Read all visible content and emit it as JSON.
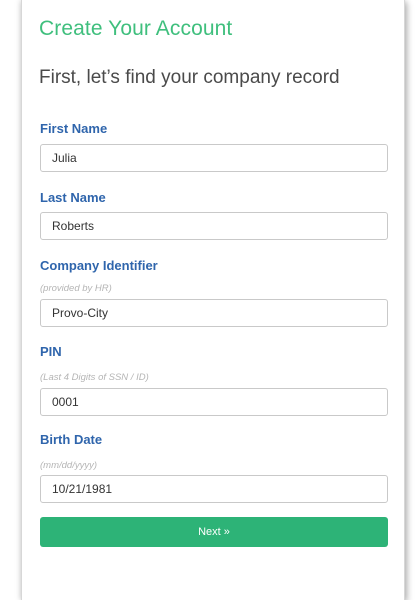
{
  "form": {
    "title": "Create Your Account",
    "subtitle": "First, let’s find your company record",
    "fields": {
      "first_name": {
        "label": "First Name",
        "value": "Julia"
      },
      "last_name": {
        "label": "Last Name",
        "value": "Roberts"
      },
      "company_identifier": {
        "label": "Company Identifier",
        "hint": "(provided by HR)",
        "value": "Provo-City"
      },
      "pin": {
        "label": "PIN",
        "hint": "(Last 4 Digits of SSN / ID)",
        "value": "0001"
      },
      "birth_date": {
        "label": "Birth Date",
        "hint": "(mm/dd/yyyy)",
        "value": "10/21/1981"
      }
    },
    "next_label": "Next »"
  },
  "colors": {
    "title": "#3fbf7d",
    "label": "#2f65ac",
    "button": "#2db377"
  }
}
